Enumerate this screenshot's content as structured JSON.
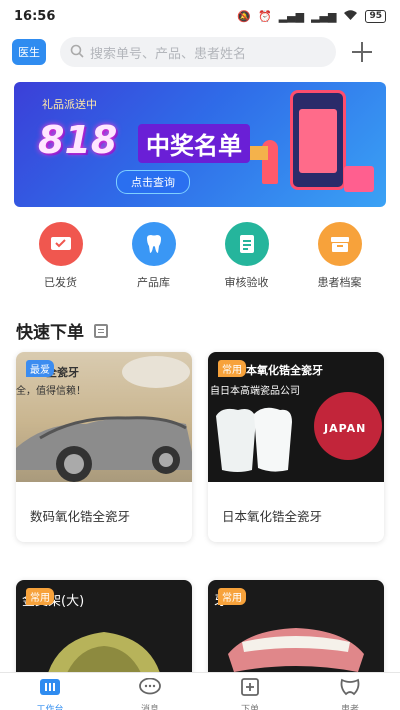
{
  "status_bar": {
    "time": "16:56",
    "battery": "95"
  },
  "header": {
    "role_badge": "医生",
    "search_placeholder": "搜索单号、产品、患者姓名"
  },
  "banner": {
    "top_text": "礼品派送中",
    "big_text": "818",
    "headline": "中奖名单",
    "button_label": "点击查询"
  },
  "shortcuts": [
    {
      "label": "已发货",
      "icon": "shipped-icon",
      "color": "#f0574f"
    },
    {
      "label": "产品库",
      "icon": "tooth-icon",
      "color": "#3a97f5"
    },
    {
      "label": "审核验收",
      "icon": "review-document-icon",
      "color": "#25b59c"
    },
    {
      "label": "患者档案",
      "icon": "patient-archive-icon",
      "color": "#f7a23b"
    }
  ],
  "quick_order": {
    "title": "快速下单",
    "products": [
      {
        "name": "数码氧化锆全瓷牙",
        "tag": "最爱",
        "overlay_line1": "全瓷牙",
        "overlay_line2": "全，值得信赖！"
      },
      {
        "name": "日本氧化锆全瓷牙",
        "tag": "常用",
        "overlay_line1": "本氧化锆全瓷牙",
        "overlay_line2": "自日本高端瓷品公司",
        "stamp": "JAPAN"
      },
      {
        "name": "",
        "tag": "常用",
        "overlay_line1": "金支架(大)"
      },
      {
        "name": "",
        "tag": "常用",
        "overlay_line1": "牙"
      }
    ]
  },
  "bottom_nav": [
    {
      "label": "工作台",
      "icon": "workbench-icon",
      "active": true
    },
    {
      "label": "消息",
      "icon": "message-icon",
      "active": false
    },
    {
      "label": "下单",
      "icon": "order-icon",
      "active": false
    },
    {
      "label": "患者",
      "icon": "patient-icon",
      "active": false
    }
  ],
  "colors": {
    "accent": "#2f8cf0",
    "tag_favorite": "#3b8cf0",
    "tag_common": "#f7a23b"
  }
}
